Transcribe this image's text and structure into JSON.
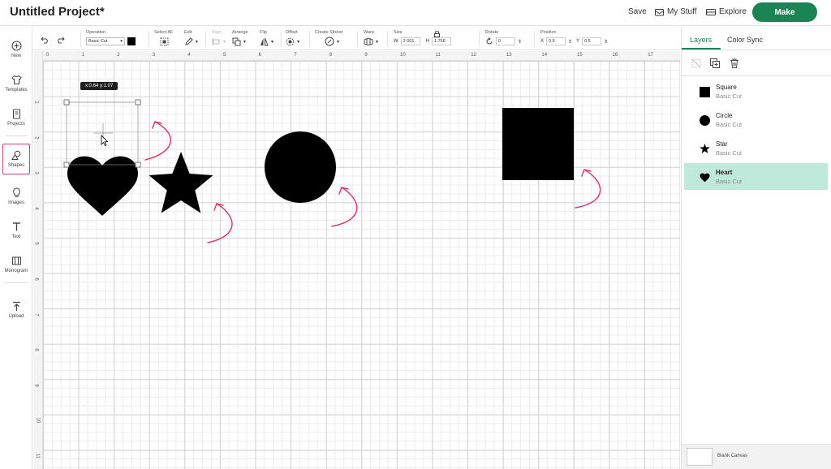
{
  "header": {
    "title": "Untitled Project*",
    "save_label": "Save",
    "mystuff_label": "My Stuff",
    "explore_label": "Explore",
    "make_label": "Make"
  },
  "sidebar": {
    "items": [
      {
        "label": "New",
        "icon": "plus-circle-icon"
      },
      {
        "label": "Templates",
        "icon": "shirt-icon"
      },
      {
        "label": "Projects",
        "icon": "projects-icon"
      },
      {
        "label": "Shapes",
        "icon": "shapes-icon"
      },
      {
        "label": "Images",
        "icon": "lightbulb-icon"
      },
      {
        "label": "Text",
        "icon": "text-icon"
      },
      {
        "label": "Monogram",
        "icon": "monogram-icon"
      },
      {
        "label": "Upload",
        "icon": "upload-icon"
      }
    ]
  },
  "toolbar": {
    "operation_label": "Operation",
    "operation_value": "Basic Cut",
    "selectall_label": "Select All",
    "edit_label": "Edit",
    "align_label": "Align",
    "arrange_label": "Arrange",
    "flip_label": "Flip",
    "offset_label": "Offset",
    "sticker_label": "Create Sticker",
    "warp_label": "Warp",
    "size_label": "Size",
    "w_label": "W",
    "w_value": "2.001",
    "h_label": "H",
    "h_value": "1.768",
    "rotate_label": "Rotate",
    "rotate_value": "0",
    "position_label": "Position",
    "x_label": "X",
    "x_value": "0.5",
    "y_label": "Y",
    "y_value": "0.5",
    "swatch_color": "#000000"
  },
  "canvas": {
    "ruler_x": [
      "0",
      "1",
      "2",
      "3",
      "4",
      "5",
      "6",
      "7",
      "8",
      "9",
      "10",
      "11",
      "12",
      "13",
      "14",
      "15",
      "16",
      "17"
    ],
    "ruler_y": [
      "1",
      "2",
      "3",
      "4",
      "5",
      "6",
      "7",
      "8",
      "9",
      "10",
      "11"
    ],
    "tooltip": "x:0.64 y:1.07",
    "arrow_color": "#d63b78"
  },
  "rpanel": {
    "tab_layers": "Layers",
    "tab_colorsync": "Color Sync",
    "layers": [
      {
        "name": "Square",
        "sub": "Basic Cut",
        "icon": "square-icon"
      },
      {
        "name": "Circle",
        "sub": "Basic Cut",
        "icon": "circle-icon"
      },
      {
        "name": "Star",
        "sub": "Basic Cut",
        "icon": "star-icon"
      },
      {
        "name": "Heart",
        "sub": "Basic Cut",
        "icon": "heart-icon",
        "selected": true
      }
    ],
    "blank_canvas": "Blank Canvas"
  }
}
